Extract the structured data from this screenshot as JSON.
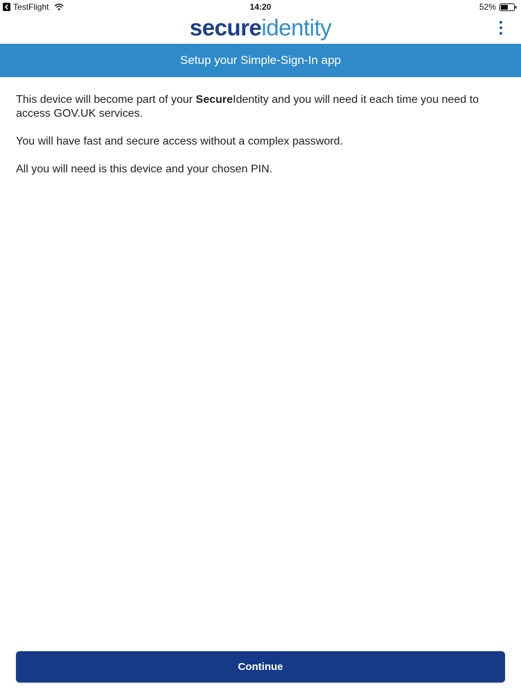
{
  "status_bar": {
    "back_app": "TestFlight",
    "time": "14:20",
    "battery": "52%"
  },
  "header": {
    "logo_part1": "secure",
    "logo_part2": "identity",
    "menu_icon": "more-vertical-icon"
  },
  "title": "Setup your Simple-Sign-In app",
  "body": {
    "p1_before": "This device will become part of your ",
    "p1_bold_secure": "Secure",
    "p1_identity": "Identity",
    "p1_after": " and you will need it each time you need to access GOV.UK services.",
    "p2": "You will have fast and secure access without a complex password.",
    "p3": "All you will need is this device and your chosen PIN."
  },
  "continue_label": "Continue",
  "colors": {
    "brand_dark": "#1c3f8a",
    "brand_light": "#2e8fcf",
    "title_bar": "#2f8ac9",
    "button": "#163a87"
  }
}
